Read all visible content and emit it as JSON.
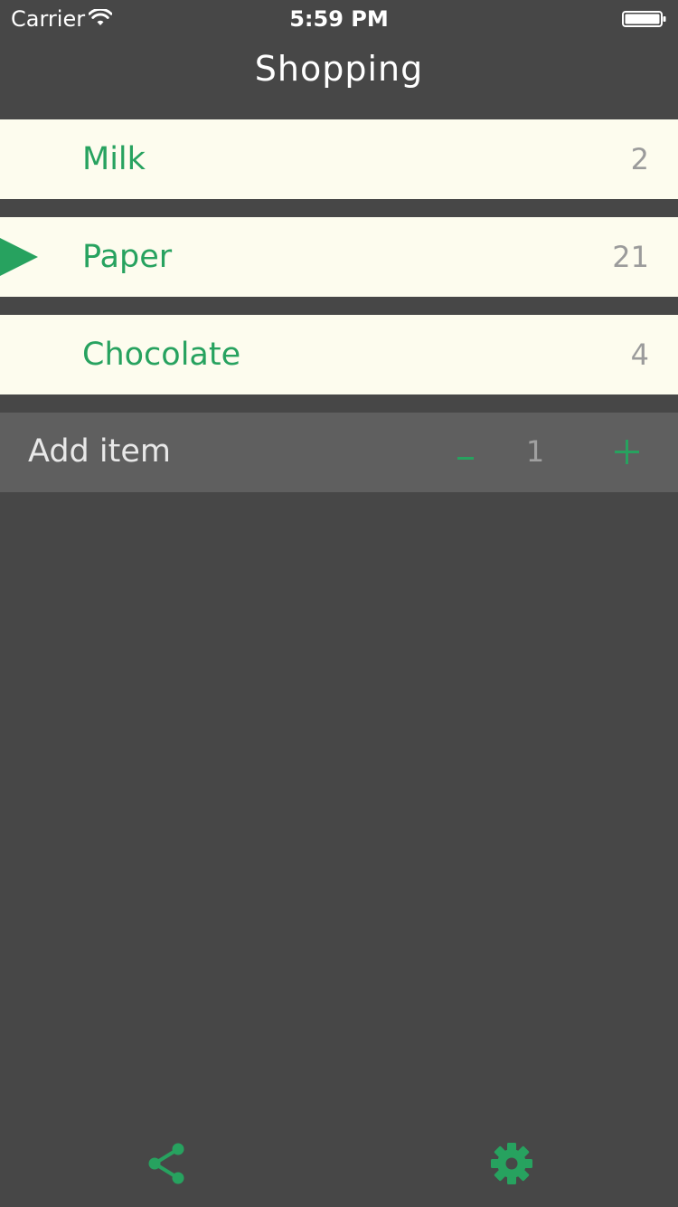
{
  "status_bar": {
    "carrier": "Carrier",
    "time": "5:59 PM"
  },
  "header": {
    "title": "Shopping"
  },
  "items": [
    {
      "name": "Milk",
      "count": "2",
      "selected": false
    },
    {
      "name": "Paper",
      "count": "21",
      "selected": true
    },
    {
      "name": "Chocolate",
      "count": "4",
      "selected": false
    }
  ],
  "add_item": {
    "label": "Add item",
    "minus": "-",
    "quantity": "1",
    "plus": "+"
  },
  "toolbar": {
    "share_icon": "share-icon",
    "settings_icon": "gear-icon"
  },
  "colors": {
    "accent": "#27a25f",
    "background": "#474747",
    "row_background": "#fdfcee",
    "add_bar_background": "#5f5f5f",
    "count_text": "#9b9b9b"
  }
}
